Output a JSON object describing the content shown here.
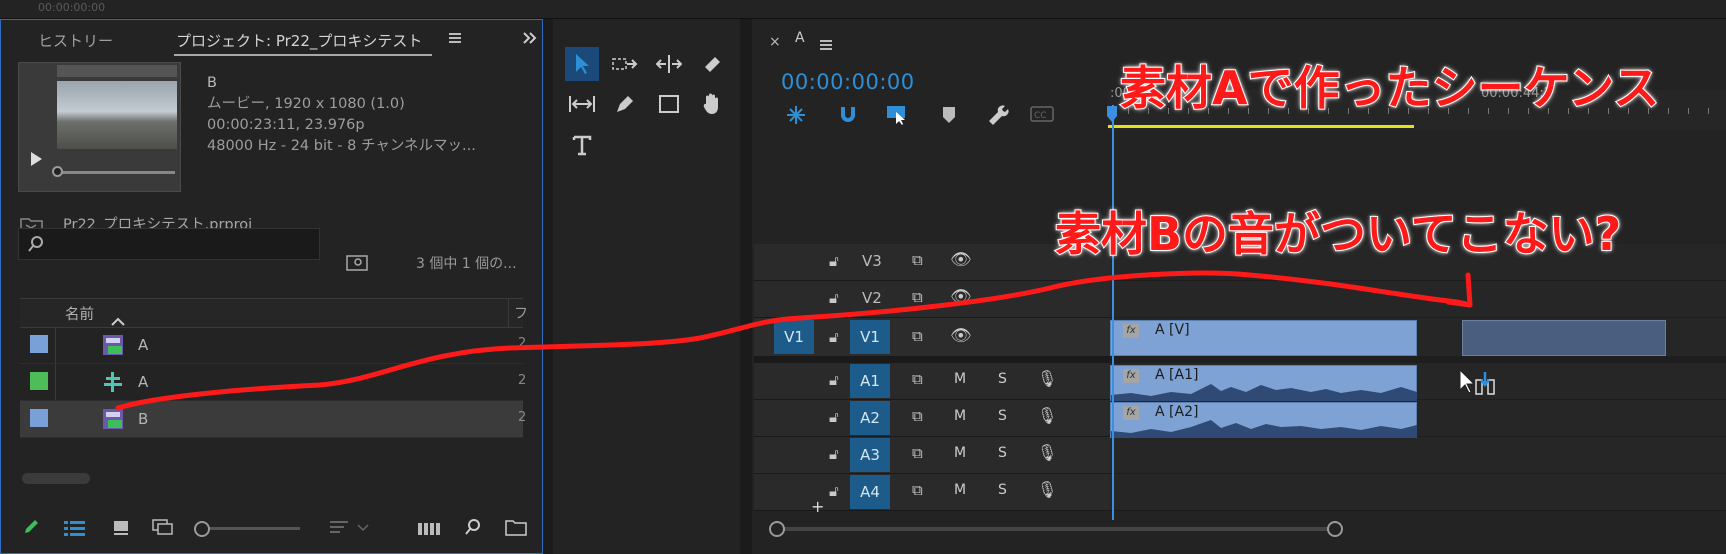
{
  "top_strip": {
    "timecode": "00:00:00:00"
  },
  "project_panel": {
    "tabs": [
      {
        "label": "ヒストリー"
      },
      {
        "label": "プロジェクト: Pr22_プロキシテスト"
      }
    ],
    "menu_icon": "hamburger-icon",
    "expand_icon": "double-chevron-icon",
    "preview": {
      "clip_name": "B",
      "type_line": "ムービー, 1920 x 1080 (1.0)",
      "duration_line": "00:00:23:11, 23.976p",
      "audio_line": "48000 Hz - 24 bit - 8 チャンネルマッ..."
    },
    "project_file": "Pr22_プロキシテスト.prproj",
    "search": {
      "placeholder": "",
      "count_text": "3 個中 1 個の..."
    },
    "column_header": {
      "name": "名前",
      "extra": "フ"
    },
    "items": [
      {
        "label": "A",
        "color": "#7aa0d8",
        "icon": "sequence-icon",
        "suffix": "2"
      },
      {
        "label": "A",
        "color": "#4cbd57",
        "icon": "audio-clip-icon",
        "suffix": "2"
      },
      {
        "label": "B",
        "color": "#7aa0d8",
        "icon": "sequence-icon",
        "suffix": "2"
      }
    ]
  },
  "timeline": {
    "sequence_name": "A",
    "timecode": "00:00:00:00",
    "ruler_label": "00:00:44:2",
    "ruler_start": ":00",
    "tracks": [
      {
        "name": "V3",
        "target": ""
      },
      {
        "name": "V2",
        "target": ""
      },
      {
        "name": "V1",
        "target": "V1"
      },
      {
        "name": "A1",
        "target": ""
      },
      {
        "name": "A2",
        "target": ""
      },
      {
        "name": "A3",
        "target": ""
      },
      {
        "name": "A4",
        "target": ""
      }
    ],
    "mute_label": "M",
    "solo_label": "S",
    "clips": {
      "video": "A [V]",
      "audio1": "A [A1]",
      "audio2": "A [A2]"
    },
    "fx_label": "fx"
  },
  "annotations": {
    "top": "素材Aで作ったシーケンス",
    "middle": "素材Bの音がついてこない?"
  },
  "colors": {
    "accent": "#2e8fd6",
    "annotation": "#ff1a1a",
    "track_target": "#1c5b8a",
    "clip": "#7ea2d4"
  }
}
